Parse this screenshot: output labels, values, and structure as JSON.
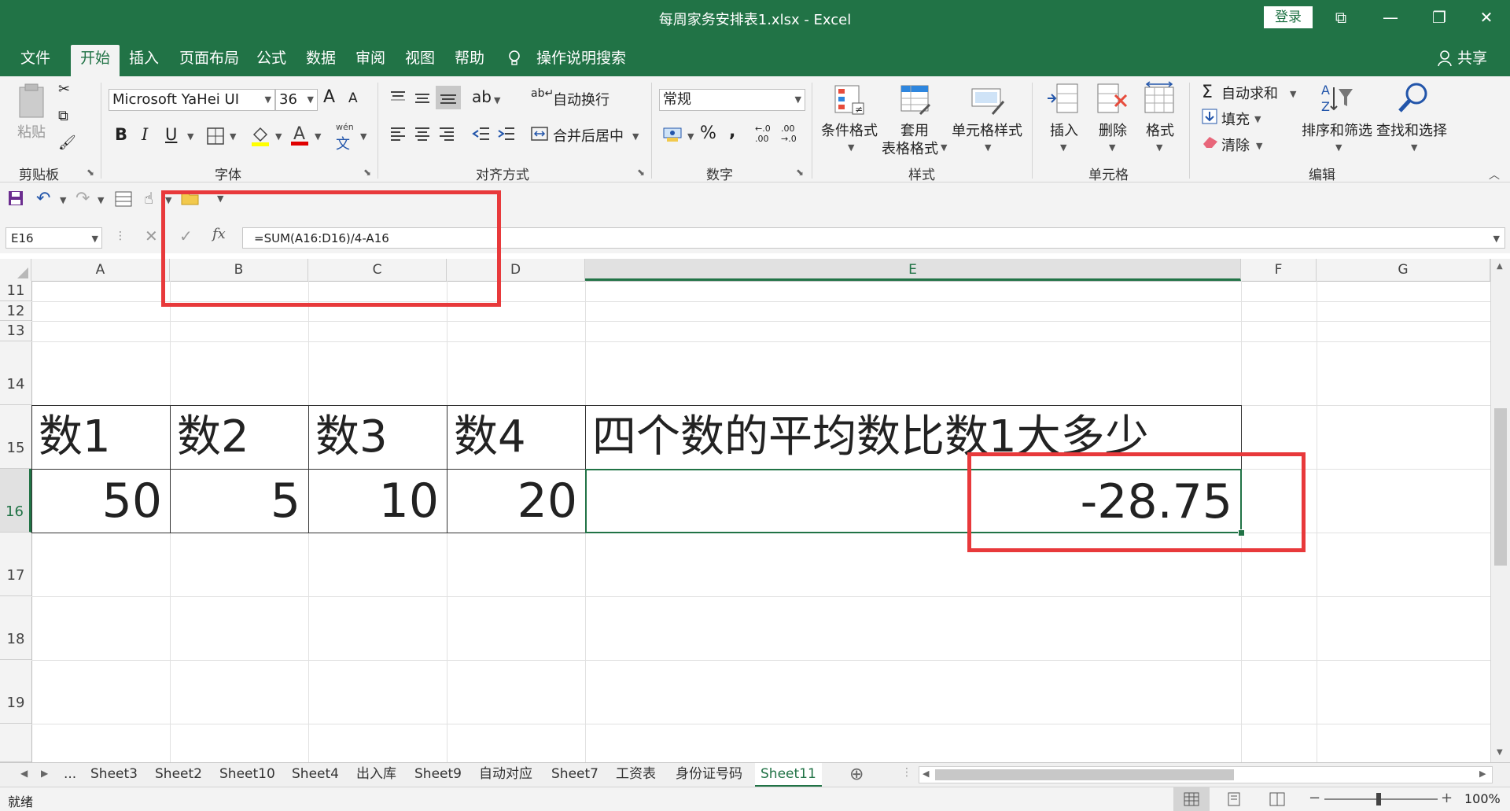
{
  "window": {
    "title": "每周家务安排表1.xlsx  -  Excel",
    "login": "登录",
    "controls": [
      "⧉",
      "—",
      "❐",
      "✕"
    ]
  },
  "ribbon_tabs": [
    "文件",
    "开始",
    "插入",
    "页面布局",
    "公式",
    "数据",
    "审阅",
    "视图",
    "帮助"
  ],
  "active_tab": "开始",
  "tell_me": "操作说明搜索",
  "share": "共享",
  "clipboard": {
    "paste": "粘贴",
    "label": "剪贴板"
  },
  "font": {
    "name": "Microsoft YaHei UI",
    "size": "36",
    "bold": "B",
    "italic": "I",
    "underline": "U",
    "grow": "A",
    "shrink": "A",
    "phonetic": "wén",
    "phonetic_char": "文",
    "label": "字体"
  },
  "alignment": {
    "wrap": "自动换行",
    "merge": "合并后居中",
    "label": "对齐方式"
  },
  "number": {
    "format": "常规",
    "percent": "%",
    "comma": ",",
    "inc": "←.0 .00",
    "dec": ".00 →.0",
    "label": "数字"
  },
  "styles": {
    "conditional": "条件格式",
    "table_line1": "套用",
    "table_line2": "表格格式",
    "cell_styles": "单元格样式",
    "label": "样式"
  },
  "cells": {
    "insert": "插入",
    "delete": "删除",
    "format": "格式",
    "label": "单元格"
  },
  "editing": {
    "autosum": "自动求和",
    "fill": "填充",
    "clear": "清除",
    "sort": "排序和筛选",
    "find": "查找和选择",
    "label": "编辑"
  },
  "formula_bar": {
    "name_box": "E16",
    "fx": "fx",
    "formula": "=SUM(A16:D16)/4-A16"
  },
  "columns": [
    "A",
    "B",
    "C",
    "D",
    "E",
    "F",
    "G"
  ],
  "rows": [
    "11",
    "12",
    "13",
    "14",
    "15",
    "16",
    "17",
    "18",
    "19"
  ],
  "table": {
    "headers": [
      "数1",
      "数2",
      "数3",
      "数4",
      "四个数的平均数比数1大多少"
    ],
    "values": [
      "50",
      "5",
      "10",
      "20",
      "-28.75"
    ]
  },
  "sheet_tabs": [
    "...",
    "Sheet3",
    "Sheet2",
    "Sheet10",
    "Sheet4",
    "出入库",
    "Sheet9",
    "自动对应",
    "Sheet7",
    "工资表",
    "身份证号码",
    "Sheet11"
  ],
  "active_sheet": "Sheet11",
  "status": {
    "ready": "就绪",
    "zoom": "100%"
  },
  "colors": {
    "accent": "#217346",
    "highlight_box": "#e8393b"
  }
}
